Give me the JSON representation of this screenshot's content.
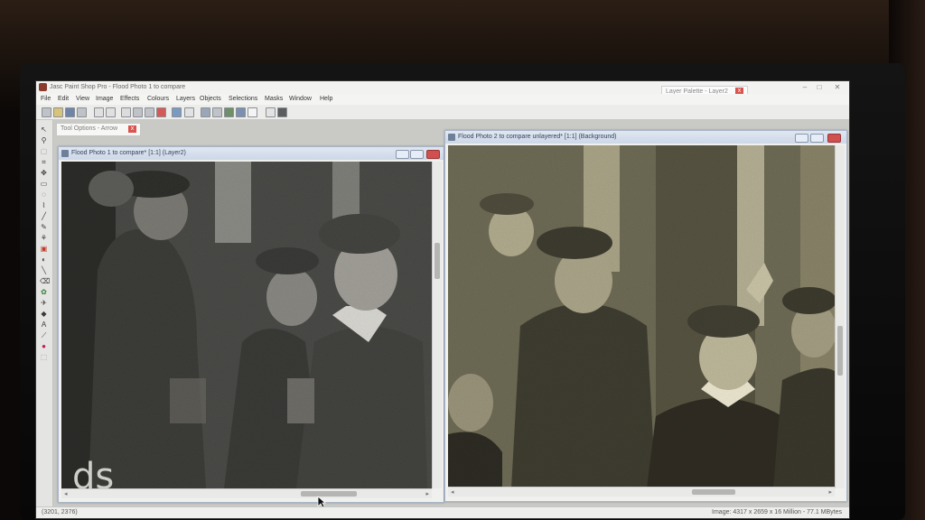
{
  "window": {
    "title": "Jasc Paint Shop Pro - Flood Photo 1 to compare",
    "controls": {
      "minimize": "–",
      "maximize": "□",
      "close": "✕"
    }
  },
  "menu": [
    "File",
    "Edit",
    "View",
    "Image",
    "Effects",
    "Colours",
    "Layers",
    "Objects",
    "Selections",
    "Masks",
    "Window",
    "Help"
  ],
  "layer_palette": {
    "label": "Layer Palette - Layer2",
    "close": "x"
  },
  "tool_options": {
    "label": "Tool Options - Arrow",
    "close": "x"
  },
  "windows": {
    "left": {
      "title": "Flood Photo 1 to compare* [1:1] (Layer2)",
      "photo_text": "ds"
    },
    "right": {
      "title": "Flood Photo 2 to compare unlayered* [1:1] (Background)"
    }
  },
  "status": {
    "coords": "(3201, 2376)",
    "image_info": "Image:  4317 x 2659 x 16 Million  -  77.1 MBytes"
  },
  "colors": {
    "left_photo_tint": "#5e5e5a",
    "right_photo_tint": "#8d8566",
    "title_bar_blue": "#cdd7e6"
  }
}
